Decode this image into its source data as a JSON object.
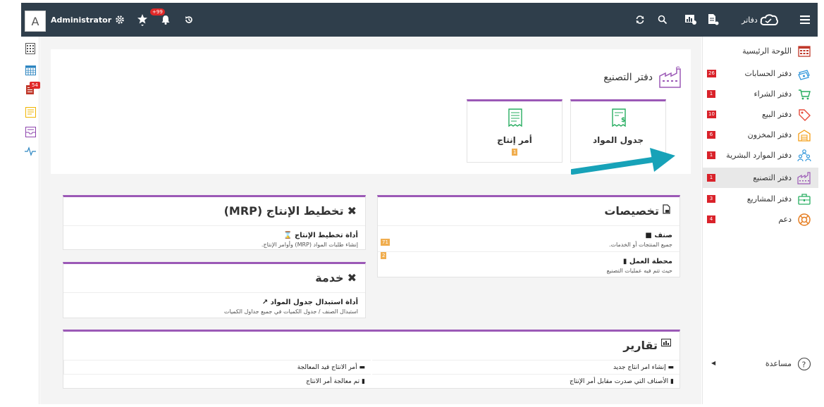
{
  "topbar": {
    "avatar_letter": "A",
    "user_name": "Administrator",
    "notifications_count": "+99",
    "brand": "دفاتر"
  },
  "left_rail": {
    "icons": [
      "calculator-icon",
      "calendar-icon",
      "clipboard-icon",
      "notes-icon",
      "inbox-icon",
      "pulse-icon"
    ],
    "clipboard_badge": "54"
  },
  "sidebar": {
    "items": [
      {
        "label": "اللوحة الرئيسية",
        "count": "",
        "icon": "dashboard-icon",
        "color": "#c0392b"
      },
      {
        "label": "دفتر الحسابات",
        "count": "26",
        "icon": "money-icon",
        "color": "#3498db"
      },
      {
        "label": "دفتر الشراء",
        "count": "1",
        "icon": "cart-icon",
        "color": "#27ae60"
      },
      {
        "label": "دفتر البيع",
        "count": "10",
        "icon": "tag-icon",
        "color": "#e74c3c"
      },
      {
        "label": "دفتر المخزون",
        "count": "6",
        "icon": "warehouse-icon",
        "color": "#f39c12"
      },
      {
        "label": "دفتر الموارد البشرية",
        "count": "1",
        "icon": "people-icon",
        "color": "#3498db"
      },
      {
        "label": "دفتر التصنيع",
        "count": "1",
        "icon": "factory-icon",
        "color": "#9b59b6"
      },
      {
        "label": "دفتر المشاريع",
        "count": "3",
        "icon": "briefcase-icon",
        "color": "#27ae60"
      },
      {
        "label": "دعم",
        "count": "4",
        "icon": "lifebuoy-icon",
        "color": "#e67e22"
      }
    ],
    "help_label": "مساعدة"
  },
  "header": {
    "title": "دفتر التصنيع",
    "tiles": [
      {
        "label": "جدول المواد",
        "count": ""
      },
      {
        "label": "أمر إنتاج",
        "count": "1"
      }
    ]
  },
  "customizations": {
    "title": "تخصيصات",
    "rows": [
      {
        "title": "صنف",
        "subtitle": "جميع المنتجات أو الخدمات.",
        "count": "71"
      },
      {
        "title": "محطة العمل",
        "subtitle": "حيث تتم فيه عمليات التصنيع",
        "count": "2"
      }
    ]
  },
  "mrp": {
    "title": "تخطيط الإنتاج (MRP)",
    "rows": [
      {
        "title": "أداة تخطيط الإنتاج",
        "subtitle": "إنشاء طلبات المواد (MRP) وأوامر الإنتاج."
      }
    ]
  },
  "service": {
    "title": "خدمة",
    "rows": [
      {
        "title": "أداة استبدال جدول المواد",
        "subtitle": "استبدال الصنف / جدول الكميات في جميع جداول الكميات"
      }
    ]
  },
  "reports": {
    "title": "تقارير",
    "items": [
      "إنشاء امر انتاج جديد",
      "أمر الانتاج قيد المعالجة",
      "الأصناف التي صدرت مقابل أمر الإنتاج",
      "تم معالجة أمر الانتاج"
    ]
  },
  "colors": {
    "topbar": "#2f3e4b",
    "accent": "#9b59b6",
    "arrow": "#17a2b8",
    "badge": "#d9222a"
  }
}
